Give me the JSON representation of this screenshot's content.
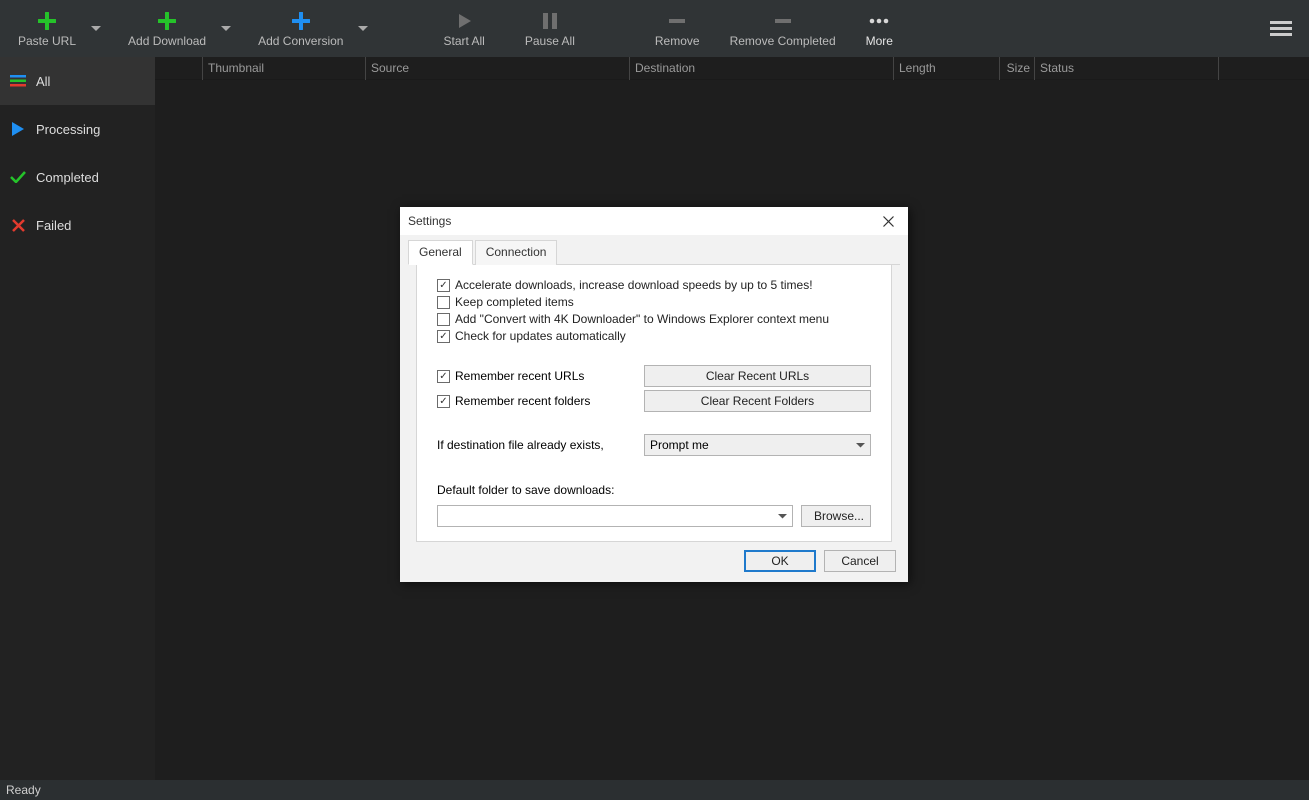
{
  "toolbar": {
    "paste_url": "Paste URL",
    "add_download": "Add Download",
    "add_conversion": "Add Conversion",
    "start_all": "Start All",
    "pause_all": "Pause All",
    "remove": "Remove",
    "remove_completed": "Remove Completed",
    "more": "More"
  },
  "sidebar": {
    "all": "All",
    "processing": "Processing",
    "completed": "Completed",
    "failed": "Failed"
  },
  "columns": {
    "thumbnail": "Thumbnail",
    "source": "Source",
    "destination": "Destination",
    "length": "Length",
    "size": "Size",
    "status": "Status"
  },
  "dialog": {
    "title": "Settings",
    "tabs": {
      "general": "General",
      "connection": "Connection"
    },
    "opts": {
      "accelerate": "Accelerate downloads, increase download speeds by up to 5 times!",
      "keep_completed": "Keep completed items",
      "context_menu": "Add \"Convert with 4K Downloader\" to Windows Explorer context menu",
      "check_updates": "Check for updates automatically",
      "remember_urls": "Remember recent URLs",
      "remember_folders": "Remember recent folders",
      "if_exists_label": "If destination file already exists,",
      "if_exists_value": "Prompt me",
      "default_folder_label": "Default folder to save downloads:",
      "default_folder_value": ""
    },
    "buttons": {
      "clear_urls": "Clear Recent URLs",
      "clear_folders": "Clear Recent Folders",
      "browse": "Browse...",
      "ok": "OK",
      "cancel": "Cancel"
    }
  },
  "status": {
    "text": "Ready"
  }
}
